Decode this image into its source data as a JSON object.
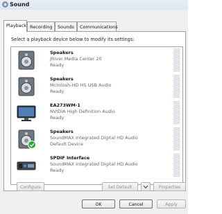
{
  "window": {
    "title": "Sound"
  },
  "tabs": [
    {
      "label": "Playback",
      "active": true
    },
    {
      "label": "Recording",
      "active": false
    },
    {
      "label": "Sounds",
      "active": false
    },
    {
      "label": "Communications",
      "active": false
    }
  ],
  "instruction": "Select a playback device below to modify its settings:",
  "devices": [
    {
      "name": "Speakers",
      "description": "JRiver Media Center 20",
      "status": "Ready",
      "icon": "speaker-icon"
    },
    {
      "name": "Speakers",
      "description": "McIntosh-HD HS USB Audio",
      "status": "Ready",
      "icon": "speaker-icon"
    },
    {
      "name": "EA273WM-1",
      "description": "NVIDIA High Definition Audio",
      "status": "Ready",
      "icon": "monitor-icon"
    },
    {
      "name": "Speakers",
      "description": "SoundMAX Integrated Digital HD Audio",
      "status": "Default Device",
      "icon": "speaker-icon",
      "default": true
    },
    {
      "name": "SPDIF Interface",
      "description": "SoundMAX Integrated Digital HD Audio",
      "status": "Ready",
      "icon": "spdif-icon"
    }
  ],
  "buttons": {
    "configure": "Configure",
    "set_default": "Set Default",
    "properties": "Properties",
    "ok": "OK",
    "cancel": "Cancel",
    "apply": "Apply"
  },
  "colors": {
    "default_check": "#2fa83a",
    "meter": "#cfd6dd"
  }
}
